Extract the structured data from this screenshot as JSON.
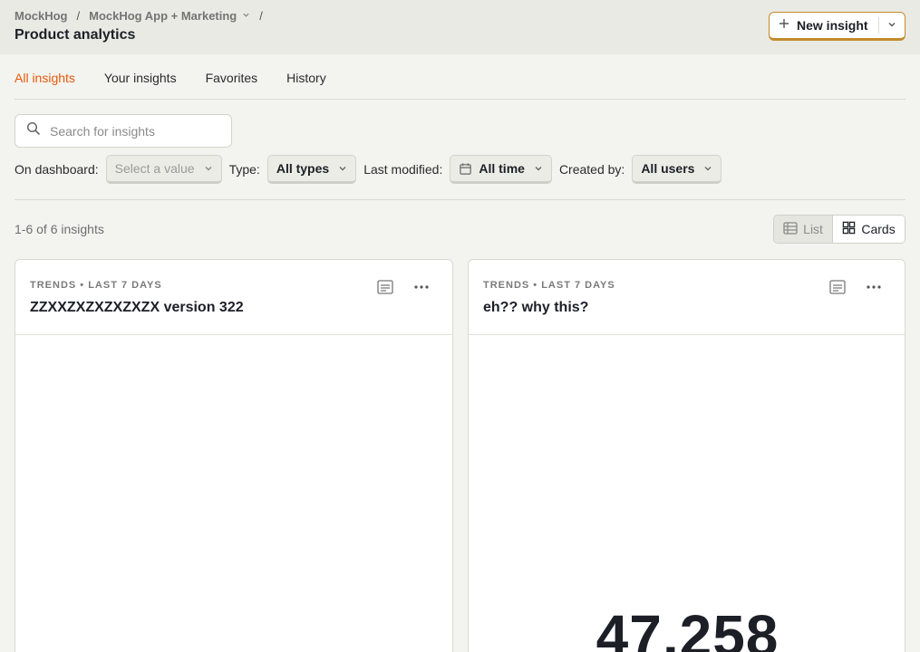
{
  "breadcrumb": {
    "org": "MockHog",
    "separator": "/",
    "project": "MockHog App + Marketing",
    "trailing_separator": "/"
  },
  "page_title": "Product analytics",
  "new_insight": {
    "label": "New insight"
  },
  "tabs": [
    {
      "label": "All insights",
      "active": true
    },
    {
      "label": "Your insights",
      "active": false
    },
    {
      "label": "Favorites",
      "active": false
    },
    {
      "label": "History",
      "active": false
    }
  ],
  "search": {
    "placeholder": "Search for insights",
    "value": ""
  },
  "filters": {
    "dashboard_label": "On dashboard:",
    "dashboard_placeholder": "Select a value",
    "type_label": "Type:",
    "type_value": "All types",
    "modified_label": "Last modified:",
    "modified_value": "All time",
    "created_label": "Created by:",
    "created_value": "All users"
  },
  "count_text": "1-6 of 6 insights",
  "view_toggle": {
    "list_label": "List",
    "cards_label": "Cards",
    "selected": "cards"
  },
  "cards": [
    {
      "meta": "Trends • Last 7 days",
      "title": "ZZXXZXZXZXZXZX version 322",
      "value": ""
    },
    {
      "meta": "Trends • Last 7 days",
      "title": "eh?? why this?",
      "value": "47,258"
    }
  ],
  "colors": {
    "accent": "#e8590c",
    "primary_border": "#c48a2c",
    "background": "#f3f4ef",
    "header_bg": "#e9eae4"
  }
}
